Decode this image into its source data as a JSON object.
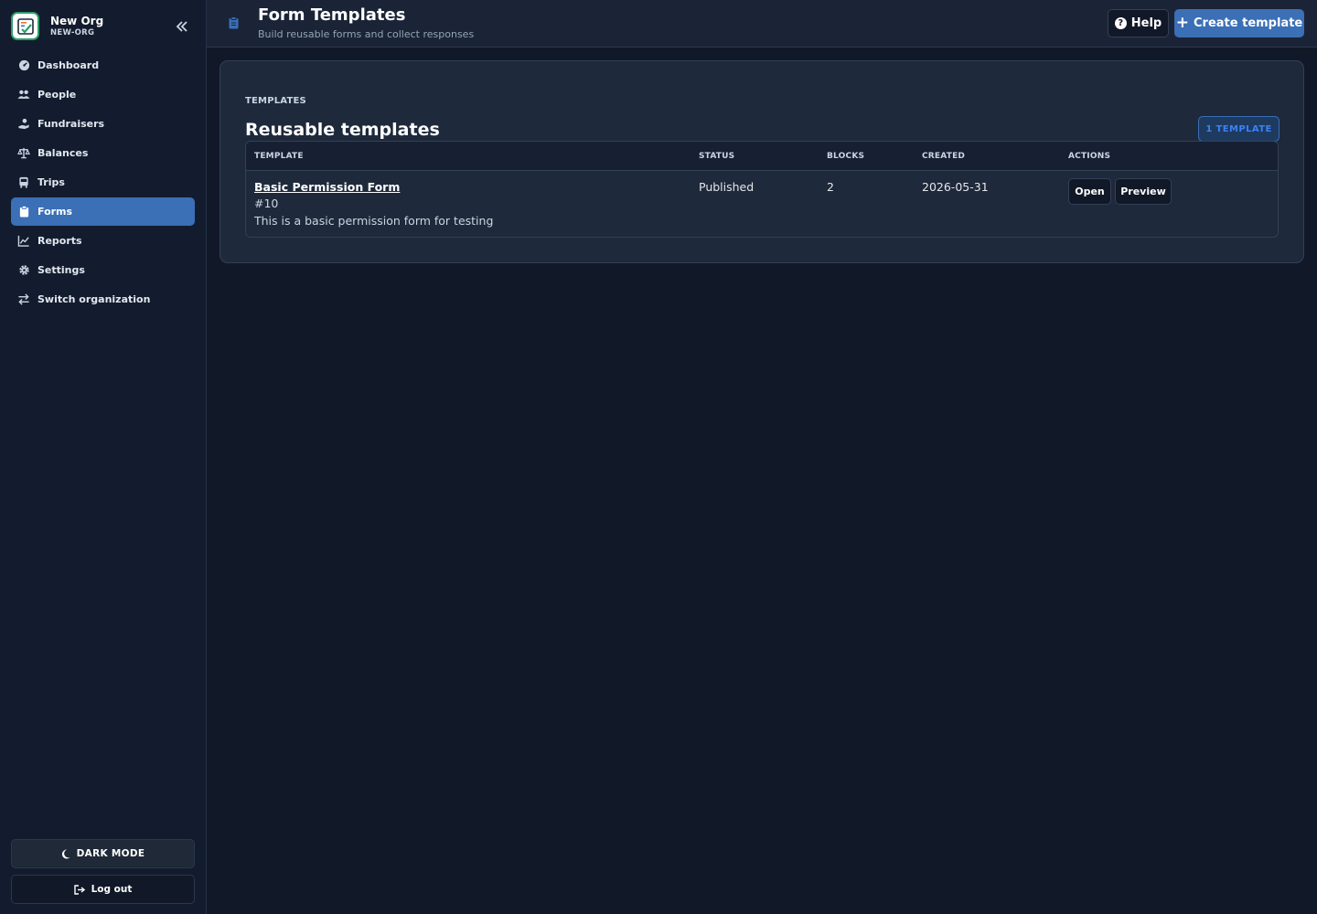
{
  "org": {
    "name": "New Org",
    "slug": "NEW-ORG"
  },
  "sidebar": {
    "items": [
      {
        "label": "Dashboard",
        "icon": "dashboard-gauge-icon"
      },
      {
        "label": "People",
        "icon": "people-icon"
      },
      {
        "label": "Fundraisers",
        "icon": "hand-coin-icon"
      },
      {
        "label": "Balances",
        "icon": "scale-icon"
      },
      {
        "label": "Trips",
        "icon": "bus-icon"
      },
      {
        "label": "Forms",
        "icon": "clipboard-icon",
        "active": true
      },
      {
        "label": "Reports",
        "icon": "chart-line-icon"
      },
      {
        "label": "Settings",
        "icon": "gear-icon"
      },
      {
        "label": "Switch organization",
        "icon": "switch-arrows-icon"
      }
    ],
    "dark_mode_label": "DARK MODE",
    "logout_label": "Log out"
  },
  "header": {
    "title": "Form Templates",
    "subtitle": "Build reusable forms and collect responses",
    "help_label": "Help",
    "create_label": "Create template"
  },
  "card": {
    "eyebrow": "TEMPLATES",
    "title": "Reusable templates",
    "count_badge": "1 TEMPLATE"
  },
  "table": {
    "columns": [
      "TEMPLATE",
      "STATUS",
      "BLOCKS",
      "CREATED",
      "ACTIONS"
    ],
    "rows": [
      {
        "name": "Basic Permission Form",
        "id": "#10",
        "description": "This is a basic permission form for testing",
        "status": "Published",
        "blocks": "2",
        "created": "2026-05-31",
        "actions": [
          "Open",
          "Preview"
        ]
      }
    ]
  },
  "colors": {
    "accent": "#3b6fb6",
    "background": "#111827",
    "sidebar": "#131c2e",
    "card": "#1e293b"
  }
}
